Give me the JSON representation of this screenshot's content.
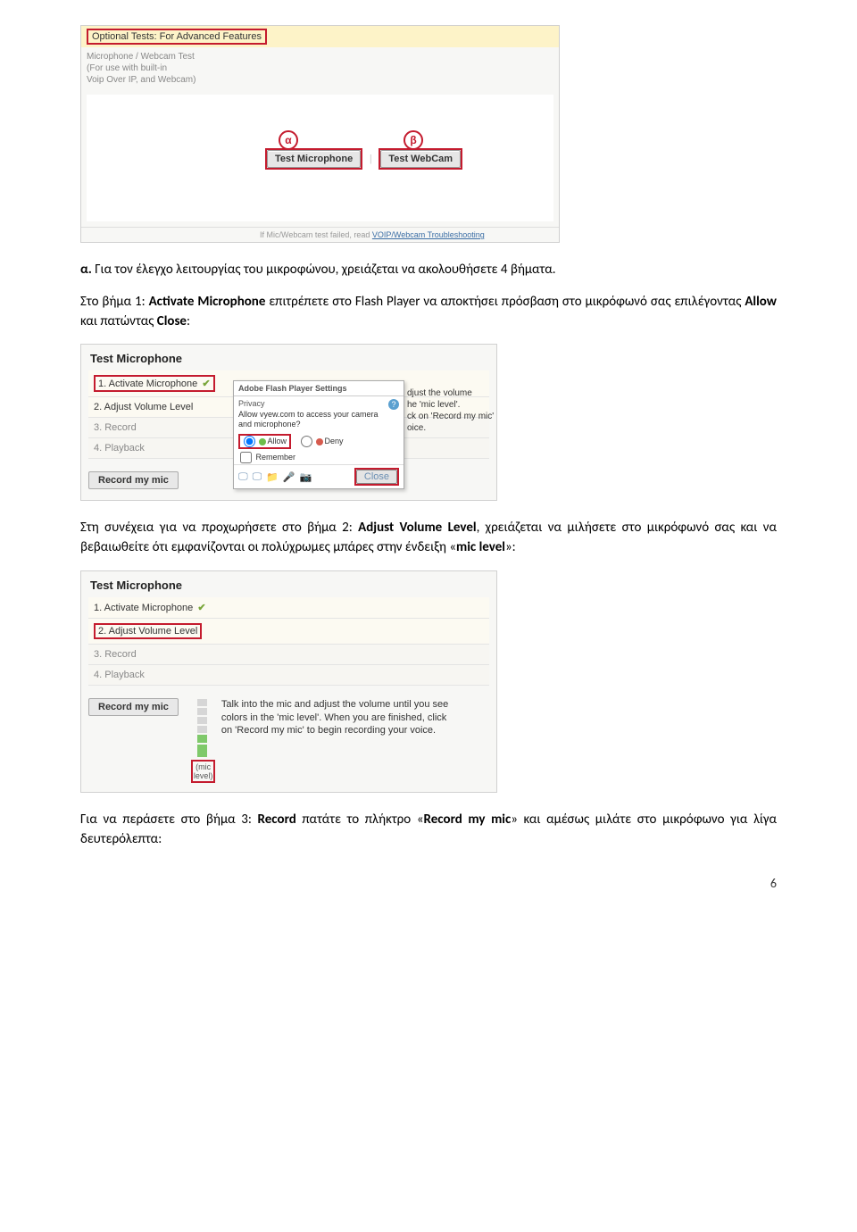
{
  "screenshot1": {
    "tab_label": "Optional Tests: For Advanced Features",
    "desc_line1": "Microphone / Webcam Test",
    "desc_line2": "(For use with built-in",
    "desc_line3": "Voip Over IP, and Webcam)",
    "label_a": "α",
    "label_b": "β",
    "btn_test_mic": "Test Microphone",
    "btn_test_webcam": "Test WebCam",
    "footnote_prefix": "If Mic/Webcam test failed, read ",
    "footnote_link": "VOIP/Webcam Troubleshooting"
  },
  "para1": {
    "prefix": "α.",
    "text": " Για τον έλεγχο λειτουργίας του μικροφώνου, χρειάζεται να ακολουθήσετε 4 βήματα."
  },
  "para2": {
    "prefix": "Στο βήμα 1: ",
    "b1": "Activate Microphone",
    "mid": " επιτρέπετε στο Flash Player να αποκτήσει πρόσβαση στο μικρόφωνό σας επιλέγοντας ",
    "b2": "Allow",
    "mid2": " και πατώντας ",
    "b3": "Close",
    "end": ":"
  },
  "panel": {
    "title": "Test Microphone",
    "step1": "1. Activate Microphone",
    "step2": "2. Adjust Volume Level",
    "step3": "3. Record",
    "step4": "4. Playback",
    "record_btn": "Record my mic"
  },
  "flash": {
    "header": "Adobe Flash Player Settings",
    "privacy": "Privacy",
    "body": "Allow vyew.com to access your camera and microphone?",
    "allow": "Allow",
    "deny": "Deny",
    "remember": "Remember",
    "close": "Close"
  },
  "sidetext": "djust the volume\nhe 'mic level'.\nck on 'Record my mic'\noice.",
  "para3": {
    "pre": "Στη συνέχεια για να προχωρήσετε στο βήμα 2: ",
    "b1": "Adjust Volume Level",
    "mid": ", χρειάζεται να μιλήσετε στο μικρόφωνό σας και να βεβαιωθείτε ότι εμφανίζονται οι πολύχρωμες μπάρες στην ένδειξη «",
    "b2": "mic level",
    "end": "»:"
  },
  "mic_level_label": "(mic level)",
  "instr_text": "Talk into the mic and adjust the volume until you see colors in the 'mic level'. When you are finished, click on 'Record my mic' to begin recording your voice.",
  "para4": {
    "pre": "Για να περάσετε στο βήμα 3: ",
    "b1": "Record",
    "mid": " πατάτε το πλήκτρο «",
    "b2": "Record my mic",
    "end": "» και αμέσως μιλάτε στο μικρόφωνο για λίγα δευτερόλεπτα:"
  },
  "page_number": "6"
}
